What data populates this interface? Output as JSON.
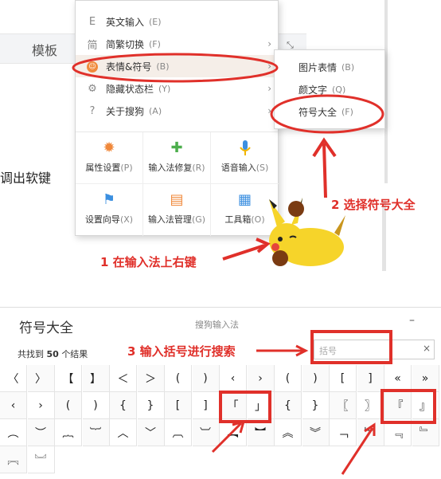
{
  "context_menu": {
    "items": [
      {
        "icon": "E",
        "label": "英文输入",
        "key": "(E)",
        "submenu": false
      },
      {
        "icon": "简",
        "label": "简繁切换",
        "key": "(F)",
        "submenu": true
      },
      {
        "icon": "☺",
        "label": "表情&符号",
        "key": "(B)",
        "submenu": true
      },
      {
        "icon": "⚙",
        "label": "隐藏状态栏",
        "key": "(Y)",
        "submenu": true
      },
      {
        "icon": "?",
        "label": "关于搜狗",
        "key": "(A)",
        "submenu": true
      }
    ],
    "tiles": [
      {
        "icon": "gear-icon",
        "glyph": "✹",
        "color": "#f0883a",
        "label": "属性设置",
        "key": "(P)"
      },
      {
        "icon": "toolbox-plus-icon",
        "glyph": "✚",
        "color": "#4cae4c",
        "label": "输入法修复",
        "key": "(R)"
      },
      {
        "icon": "microphone-icon",
        "glyph": "🎤",
        "color": "#3b8fe0",
        "label": "语音输入",
        "key": "(S)"
      },
      {
        "icon": "flag-icon",
        "glyph": "⚑",
        "color": "#3b8fe0",
        "label": "设置向导",
        "key": "(X)"
      },
      {
        "icon": "manager-icon",
        "glyph": "▤",
        "color": "#f0883a",
        "label": "输入法管理",
        "key": "(G)"
      },
      {
        "icon": "toolbox-icon",
        "glyph": "▦",
        "color": "#3b8fe0",
        "label": "工具箱",
        "key": "(O)"
      }
    ]
  },
  "sub_menu": {
    "items": [
      {
        "label": "图片表情",
        "key": "(B)"
      },
      {
        "label": "颜文字",
        "key": "(Q)"
      },
      {
        "label": "符号大全",
        "key": "(F)"
      }
    ]
  },
  "background": {
    "template_label": "模板",
    "side_text": "调出软键",
    "expand_icon": "⤡"
  },
  "annotations": {
    "step1": "1 在输入法上右键",
    "step2": "2 选择符号大全",
    "step3": "3 输入括号进行搜索",
    "color": "#e0302a"
  },
  "dialog": {
    "title": "符号大全",
    "app_name": "搜狗输入法",
    "minimize": "–",
    "count_prefix": "共找到",
    "count": "50",
    "count_suffix": "个结果",
    "search_placeholder": "括号",
    "clear": "×",
    "rows": [
      [
        "〈",
        "〉",
        "【",
        "】",
        "＜",
        "＞",
        "(",
        ")",
        "‹",
        "›",
        "(",
        ")",
        "[",
        "]",
        "«",
        "»"
      ],
      [
        "‹",
        "›",
        "(",
        ")",
        "{",
        "}",
        "[",
        "]",
        "「",
        "」",
        "{",
        "}",
        "〖",
        "〗",
        "『",
        "』"
      ],
      [
        "︵",
        "︶",
        "︷",
        "︸",
        "︿",
        "﹀",
        "︹",
        "︺",
        "︻",
        "︼",
        "︽",
        "︾",
        "﹁",
        "﹂",
        "﹃",
        "﹄"
      ],
      [
        "︗",
        "︘"
      ]
    ]
  }
}
